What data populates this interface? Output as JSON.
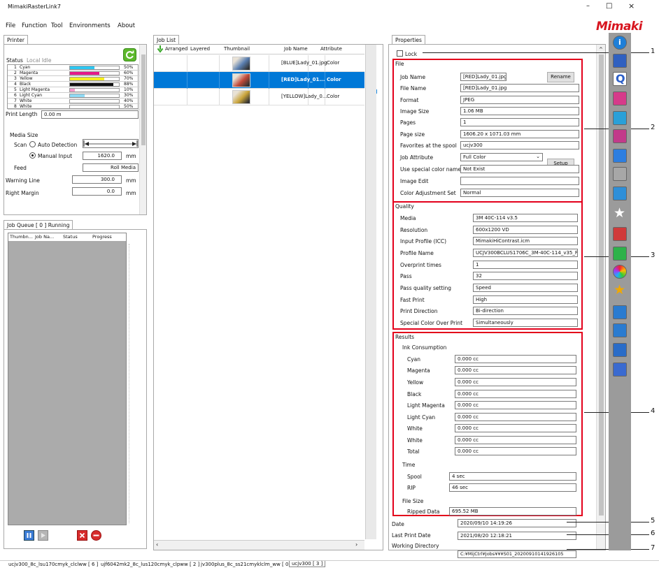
{
  "window": {
    "title": "MimakiRasterLink7",
    "logo": "Mimaki",
    "controls": [
      "–",
      "□",
      "×"
    ]
  },
  "menu": [
    "File",
    "Function",
    "Tool",
    "Environments",
    "About"
  ],
  "printer": {
    "tab": "Printer",
    "status_label": "Status",
    "status_value": "Local Idle",
    "inks": [
      {
        "num": "1",
        "name": "Cyan",
        "pct": "50%",
        "level": 0.5,
        "color": "#2ec7f2"
      },
      {
        "num": "2",
        "name": "Magenta",
        "pct": "60%",
        "level": 0.6,
        "color": "#e6198a"
      },
      {
        "num": "3",
        "name": "Yellow",
        "pct": "70%",
        "level": 0.7,
        "color": "#f6ee1f"
      },
      {
        "num": "4",
        "name": "Black",
        "pct": "88%",
        "level": 0.88,
        "color": "#111111"
      },
      {
        "num": "5",
        "name": "Light Magenta",
        "pct": "10%",
        "level": 0.1,
        "color": "#f59acb"
      },
      {
        "num": "6",
        "name": "Light Cyan",
        "pct": "30%",
        "level": 0.3,
        "color": "#8fdaf5"
      },
      {
        "num": "7",
        "name": "White",
        "pct": "40%",
        "level": 0.4,
        "color": "#ffffff"
      },
      {
        "num": "8",
        "name": "White",
        "pct": "50%",
        "level": 0.5,
        "color": "#ffffff"
      }
    ],
    "print_length_label": "Print Length",
    "print_length_value": "0.00 m",
    "media_size_label": "Media Size",
    "scan_label": "Scan",
    "auto_detection": "Auto Detection",
    "manual_input": "Manual Input",
    "manual_value": "1620.0",
    "mm": "mm",
    "feed_label": "Feed",
    "feed_value": "Roll Media",
    "warning_label": "Warning Line",
    "warning_value": "300.0",
    "right_margin_label": "Right Margin",
    "right_margin_value": "0.0"
  },
  "job_queue": {
    "tab": "Job Queue [ 0 ] Running",
    "cols": [
      "Thumbn...",
      "Job Na...",
      "Status",
      "Progress"
    ]
  },
  "job_list": {
    "tab": "Job List",
    "cols": [
      "Arranged",
      "Layered",
      "Thumbnail",
      "Job Name",
      "Attribute"
    ],
    "rows": [
      {
        "name": "[BLUE]Lady_01.jpg",
        "attr": "Color",
        "selected": false
      },
      {
        "name": "[RED]Lady_01...",
        "attr": "Color",
        "selected": true
      },
      {
        "name": "[YELLOW]Lady_0...",
        "attr": "Color",
        "selected": false
      }
    ]
  },
  "properties": {
    "tab": "Properties",
    "lock": "Lock",
    "file": {
      "title": "File",
      "rename": "Rename",
      "setup": "Setup",
      "rows": [
        {
          "label": "Job Name",
          "value": "[RED]Lady_01.jpg"
        },
        {
          "label": "File Name",
          "value": "[RED]Lady_01.jpg"
        },
        {
          "label": "Format",
          "value": "JPEG"
        },
        {
          "label": "Image Size",
          "value": "1.06 MB"
        },
        {
          "label": "Pages",
          "value": "1"
        },
        {
          "label": "Page size",
          "value": "1606.20 x 1071.03 mm"
        },
        {
          "label": "Favorites at the spool",
          "value": "ucjv300"
        },
        {
          "label": "Job Attribute",
          "value": "Full Color"
        },
        {
          "label": "Use special color names",
          "value": "Not Exist"
        },
        {
          "label": "Image Edit",
          "value": ""
        },
        {
          "label": "Color Adjustment Set",
          "value": "Normal"
        }
      ]
    },
    "quality": {
      "title": "Quality",
      "rows": [
        {
          "label": "Media",
          "value": "3M 40C-114 v3.5"
        },
        {
          "label": "Resolution",
          "value": "600x1200 VD"
        },
        {
          "label": "Input Profile (ICC)",
          "value": "MimakiHiContrast.icm"
        },
        {
          "label": "Profile Name",
          "value": "UCJV300BCLUS1706C_3M-40C-114_v35_F"
        },
        {
          "label": "Overprint times",
          "value": "1"
        },
        {
          "label": "Pass",
          "value": "32"
        },
        {
          "label": "Pass quality setting",
          "value": "Speed"
        },
        {
          "label": "Fast Print",
          "value": "High"
        },
        {
          "label": "Print Direction",
          "value": "Bi-direction"
        },
        {
          "label": "Special Color Over Print",
          "value": "Simultaneously"
        }
      ]
    },
    "results": {
      "title": "Results",
      "ink_title": "Ink Consumption",
      "ink": [
        {
          "label": "Cyan",
          "value": "0.000 cc"
        },
        {
          "label": "Magenta",
          "value": "0.000 cc"
        },
        {
          "label": "Yellow",
          "value": "0.000 cc"
        },
        {
          "label": "Black",
          "value": "0.000 cc"
        },
        {
          "label": "Light Magenta",
          "value": "0.000 cc"
        },
        {
          "label": "Light Cyan",
          "value": "0.000 cc"
        },
        {
          "label": "White",
          "value": "0.000 cc"
        },
        {
          "label": "White",
          "value": "0.000 cc"
        },
        {
          "label": "Total",
          "value": "0.000 cc"
        }
      ],
      "time_title": "Time",
      "time": [
        {
          "label": "Spool",
          "value": "4 sec"
        },
        {
          "label": "RIP",
          "value": "46 sec"
        }
      ],
      "filesize_title": "File Size",
      "filesize": {
        "label": "Ripped Data",
        "value": "695.52 MB"
      }
    },
    "date_label": "Date",
    "date_value": "2020/09/10 14:19:26",
    "last_print_label": "Last Print Date",
    "last_print_value": "2021/08/20 12:18:21",
    "workdir_label": "Working Directory",
    "workdir_value": "C:¥MijCtrl¥Jobs¥¥¥S01_20200910141926105"
  },
  "callouts": [
    "1",
    "2",
    "3",
    "4",
    "5",
    "6",
    "7"
  ],
  "statusbar": [
    "ucjv300_8c_lsu170cmyk_clclww [ 6 ]",
    "ujf6042mk2_8c_lus120cmyk_clpww [ 2 ]",
    "jv300plus_8c_ss21cmyklclm_ww [ 0 ]",
    "ucjv300 [ 3 ]"
  ],
  "toolbar_icons": [
    "info-icon",
    "print-queue-icon",
    "quality-icon",
    "crop-icon",
    "page-icon",
    "layout-icon",
    "tiling-icon",
    "copy-icon",
    "color-icon",
    "favorite-star-icon",
    "report-icon",
    "eye-icon",
    "color-wheel-icon",
    "star-icon",
    "document-icon",
    "duplicate-icon",
    "trash-icon",
    "help-icon"
  ]
}
